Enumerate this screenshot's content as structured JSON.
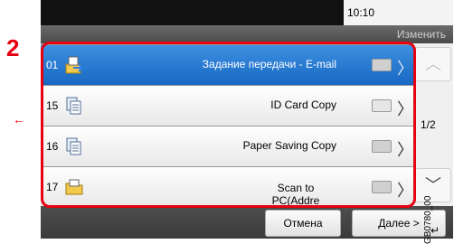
{
  "callout_number": "2",
  "status": {
    "time": "10:10"
  },
  "edit_button": "Изменить",
  "rows": [
    {
      "number": "01",
      "label": "Задание передачи - E-mail",
      "icon": "email-send-icon",
      "selected": true
    },
    {
      "number": "15",
      "label": "ID Card Copy",
      "icon": "copy-pages-icon",
      "selected": false
    },
    {
      "number": "16",
      "label": "Paper Saving Copy",
      "icon": "copy-pages-icon",
      "selected": false
    },
    {
      "number": "17",
      "label": "Scan to PC(Addre\ness Entry)",
      "icon": "folder-scan-icon",
      "selected": false
    }
  ],
  "page_indicator": "1/2",
  "buttons": {
    "cancel": "Отмена",
    "next": "Далее >"
  },
  "doc_id": "GB0780_00",
  "colors": {
    "accent_red": "#e60012",
    "selected_blue": "#1769c3"
  }
}
